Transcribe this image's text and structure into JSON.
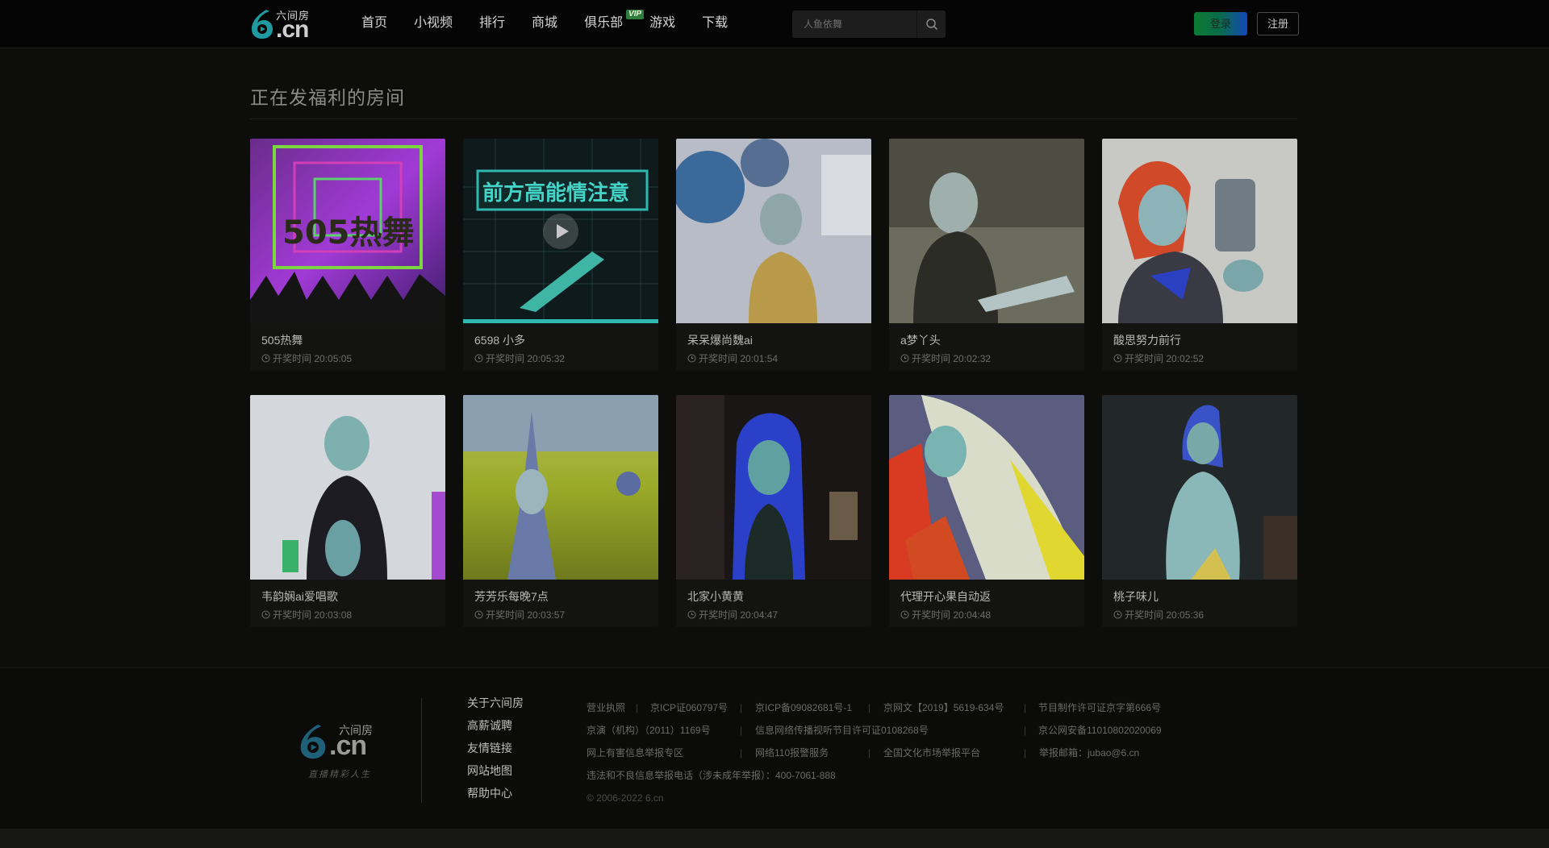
{
  "header": {
    "logo_text_top": "六间房",
    "logo_text_main": ".cn",
    "nav": [
      {
        "label": "首页"
      },
      {
        "label": "小视频"
      },
      {
        "label": "排行"
      },
      {
        "label": "商城"
      },
      {
        "label": "俱乐部",
        "badge": "VIP"
      },
      {
        "label": "游戏"
      },
      {
        "label": "下载"
      }
    ],
    "search": {
      "placeholder": "人鱼依舞",
      "icon": "search-icon"
    },
    "login_label": "登录",
    "register_label": "注册"
  },
  "main": {
    "section_title": "正在发福利的房间",
    "time_prefix": "开奖时间",
    "rooms": [
      {
        "name": "505热舞",
        "time": "20:05:05"
      },
      {
        "name": "6598 小多",
        "time": "20:05:32"
      },
      {
        "name": "呆呆爆尚魏ai",
        "time": "20:01:54"
      },
      {
        "name": "a梦丫头",
        "time": "20:02:32"
      },
      {
        "name": "酸思努力前行",
        "time": "20:02:52"
      },
      {
        "name": "韦韵娴ai爱唱歌",
        "time": "20:03:08"
      },
      {
        "name": "芳芳乐每晚7点",
        "time": "20:03:57"
      },
      {
        "name": "北家小黄黄",
        "time": "20:04:47"
      },
      {
        "name": "代理开心果自动返",
        "time": "20:04:48"
      },
      {
        "name": "桃子味儿",
        "time": "20:05:36"
      }
    ]
  },
  "footer": {
    "logo_top": "六间房",
    "logo_main": ".cn",
    "logo_slogan": "直播精彩人生",
    "links": [
      "关于六间房",
      "高薪诚聘",
      "友情链接",
      "网站地图",
      "帮助中心"
    ],
    "info_row1": [
      "营业执照",
      "京ICP证060797号",
      "京ICP备09082681号-1",
      "京网文【2019】5619-634号",
      "节目制作许可证京字第666号"
    ],
    "info_row2": [
      "京演（机构）（2011）1169号",
      "信息网络传播视听节目许可证0108268号",
      "京公网安备11010802020069"
    ],
    "info_row3": [
      "网上有害信息举报专区",
      "网络110报警服务",
      "全国文化市场举报平台",
      "举报邮箱：jubao@6.cn"
    ],
    "info_row4": "违法和不良信息举报电话（涉未成年举报）：400-7061-888",
    "copyright": "© 2006-2022 6.cn",
    "separator": "|"
  }
}
